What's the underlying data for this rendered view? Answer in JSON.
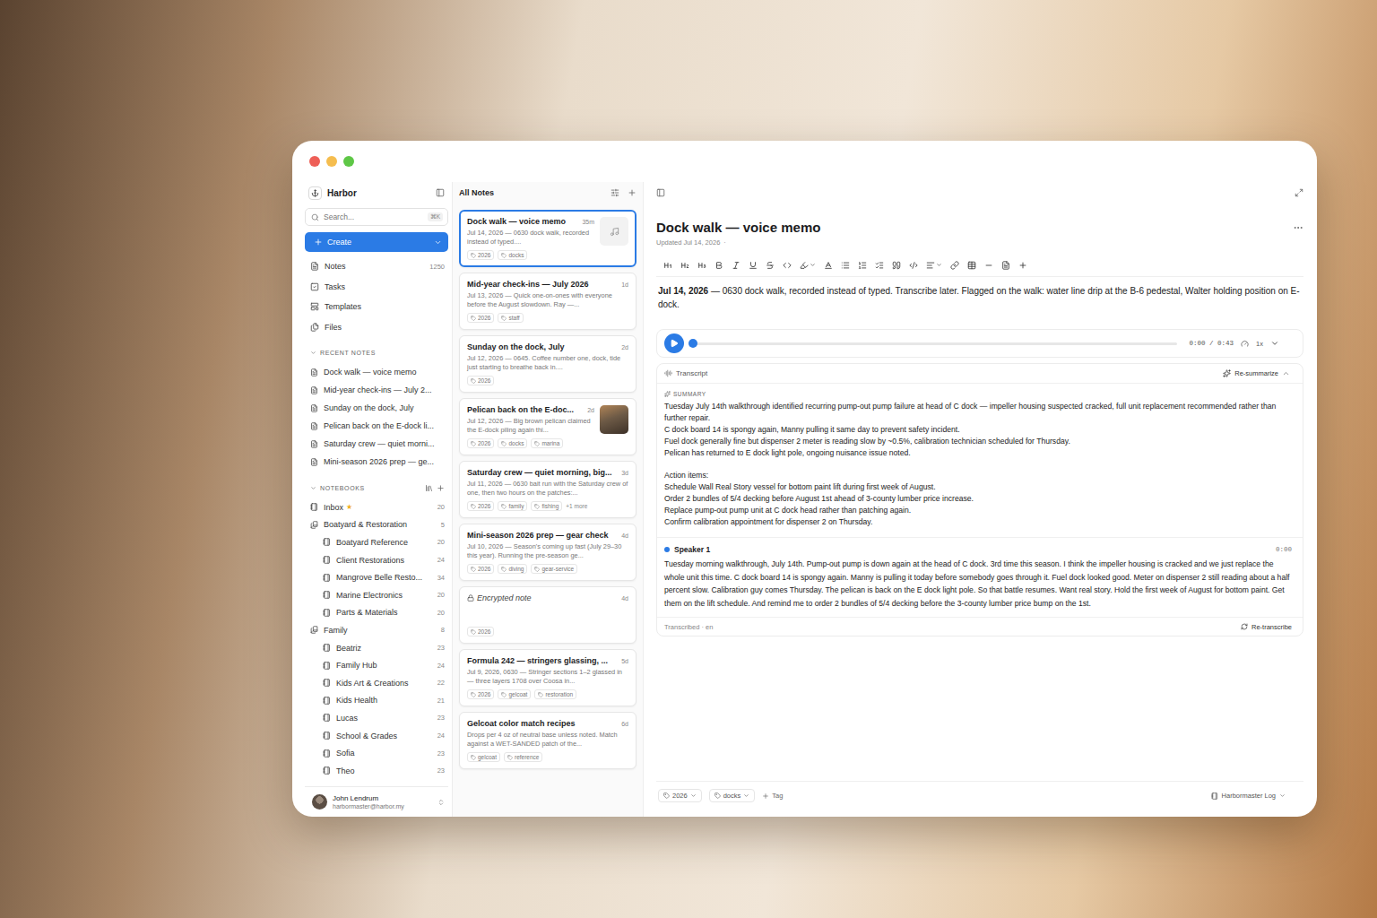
{
  "window": {
    "title": "Harbor"
  },
  "sidebar": {
    "app_name": "Harbor",
    "search": {
      "placeholder": "Search...",
      "shortcut": "⌘K"
    },
    "create_button": "Create",
    "nav": [
      {
        "label": "Notes",
        "count": "1250"
      },
      {
        "label": "Tasks"
      },
      {
        "label": "Templates"
      },
      {
        "label": "Files"
      }
    ],
    "recent_heading": "RECENT NOTES",
    "recent": [
      "Dock walk — voice memo",
      "Mid-year check-ins — July 2...",
      "Sunday on the dock, July",
      "Pelican back on the E-dock li...",
      "Saturday crew — quiet morni...",
      "Mini-season 2026 prep — ge..."
    ],
    "notebooks_heading": "NOTEBOOKS",
    "notebooks": [
      {
        "kind": "notebook",
        "label": "Inbox",
        "count": "20",
        "starred": true
      },
      {
        "kind": "group",
        "label": "Boatyard & Restoration",
        "count": "5",
        "starred": false
      },
      {
        "kind": "child",
        "label": "Boatyard Reference",
        "count": "20",
        "starred": false
      },
      {
        "kind": "child",
        "label": "Client Restorations",
        "count": "24",
        "starred": false
      },
      {
        "kind": "child",
        "label": "Mangrove Belle Resto...",
        "count": "34",
        "starred": false
      },
      {
        "kind": "child",
        "label": "Marine Electronics",
        "count": "20",
        "starred": false
      },
      {
        "kind": "child",
        "label": "Parts & Materials",
        "count": "20",
        "starred": false
      },
      {
        "kind": "group",
        "label": "Family",
        "count": "8",
        "starred": false
      },
      {
        "kind": "child",
        "label": "Beatriz",
        "count": "23",
        "starred": false
      },
      {
        "kind": "child",
        "label": "Family Hub",
        "count": "24",
        "starred": false
      },
      {
        "kind": "child",
        "label": "Kids Art & Creations",
        "count": "22",
        "starred": false
      },
      {
        "kind": "child",
        "label": "Kids Health",
        "count": "21",
        "starred": false
      },
      {
        "kind": "child",
        "label": "Lucas",
        "count": "23",
        "starred": false
      },
      {
        "kind": "child",
        "label": "School & Grades",
        "count": "24",
        "starred": false
      },
      {
        "kind": "child",
        "label": "Sofia",
        "count": "23",
        "starred": false
      },
      {
        "kind": "child",
        "label": "Theo",
        "count": "23",
        "starred": false
      }
    ],
    "star": "★",
    "user": {
      "name": "John Lendrum",
      "email": "harbormaster@harbor.my"
    }
  },
  "note_list": {
    "title": "All Notes",
    "notes": [
      {
        "kind": "audio",
        "selected": true,
        "title": "Dock walk — voice memo",
        "age": "35m",
        "snippet": "Jul 14, 2026 — 0630 dock walk, recorded instead of typed....",
        "tags": [
          "2026",
          "docks"
        ]
      },
      {
        "kind": "plain",
        "selected": false,
        "title": "Mid-year check-ins — July 2026",
        "age": "1d",
        "snippet": "Jul 13, 2026 — Quick one-on-ones with everyone before the August slowdown. Ray —...",
        "tags": [
          "2026",
          "staff"
        ]
      },
      {
        "kind": "plain",
        "selected": false,
        "title": "Sunday on the dock, July",
        "age": "2d",
        "snippet": "Jul 12, 2026 — 0645. Coffee number one, dock, tide just starting to breathe back in....",
        "tags": [
          "2026"
        ]
      },
      {
        "kind": "photo",
        "selected": false,
        "title": "Pelican back on the E-doc...",
        "age": "2d",
        "snippet": "Jul 12, 2026 — Big brown pelican claimed the E-dock piling again thi...",
        "tags": [
          "2026",
          "docks",
          "marina"
        ]
      },
      {
        "kind": "plain",
        "selected": false,
        "title": "Saturday crew — quiet morning, big...",
        "age": "3d",
        "snippet": "Jul 11, 2026 — 0630 bait run with the Saturday crew of one, then two hours on the patches:...",
        "tags": [
          "2026",
          "family",
          "fishing"
        ],
        "more": "+1 more"
      },
      {
        "kind": "plain",
        "selected": false,
        "title": "Mini-season 2026 prep — gear check",
        "age": "4d",
        "snippet": "Jul 10, 2026 — Season's coming up fast (July 29–30 this year). Running the pre-season ge...",
        "tags": [
          "2026",
          "diving",
          "gear-service"
        ]
      },
      {
        "kind": "encrypted",
        "selected": false,
        "title": "Encrypted note",
        "age": "4d",
        "snippet": "",
        "tags": [
          "2026"
        ]
      },
      {
        "kind": "plain",
        "selected": false,
        "title": "Formula 242 — stringers glassing, ...",
        "age": "5d",
        "snippet": "Jul 9, 2026, 0630 — Stringer sections 1–2 glassed in — three layers 1708 over Coosa in...",
        "tags": [
          "2026",
          "gelcoat",
          "restoration"
        ]
      },
      {
        "kind": "plain",
        "selected": false,
        "title": "Gelcoat color match recipes",
        "age": "6d",
        "snippet": "Drops per 4 oz of neutral base unless noted. Match against a WET-SANDED patch of the...",
        "tags": [
          "gelcoat",
          "reference"
        ]
      }
    ]
  },
  "editor": {
    "title": "Dock walk — voice memo",
    "updated": "Updated Jul 14, 2026",
    "updated_sep": "·",
    "body_date": "Jul 14, 2026",
    "body_text": " — 0630 dock walk, recorded instead of typed. Transcribe later. Flagged on the walk: water line drip at the B-6 pedestal, Walter holding position on E-dock.",
    "player": {
      "time": "0:00 / 0:43",
      "speed": "1x",
      "level": 0
    },
    "transcript": {
      "label": "Transcript",
      "resummarize": "Re-summarize",
      "summary_heading": "SUMMARY",
      "summary": [
        "Tuesday July 14th walkthrough identified recurring pump-out pump failure at head of C dock — impeller housing suspected cracked, full unit replacement recommended rather than further repair.",
        "C dock board 14 is spongy again, Manny pulling it same day to prevent safety incident.",
        "Fuel dock generally fine but dispenser 2 meter is reading slow by ~0.5%, calibration technician scheduled for Thursday.",
        "Pelican has returned to E dock light pole, ongoing nuisance issue noted."
      ],
      "action_heading": "Action items:",
      "actions": [
        "Schedule Wall Real Story vessel for bottom paint lift during first week of August.",
        "Order 2 bundles of 5/4 decking before August 1st ahead of 3-county lumber price increase.",
        "Replace pump-out pump unit at C dock head rather than patching again.",
        "Confirm calibration appointment for dispenser 2 on Thursday."
      ],
      "speaker": "Speaker 1",
      "speaker_time": "0:00",
      "text": "Tuesday morning walkthrough, July 14th. Pump-out pump is down again at the head of C dock. 3rd time this season. I think the impeller housing is cracked and we just replace the whole unit this time. C dock board 14 is spongy again. Manny is pulling it today before somebody goes through it. Fuel dock looked good. Meter on dispenser 2 still reading about a half percent slow. Calibration guy comes Thursday. The pelican is back on the E dock light pole. So that battle resumes. Want real story. Hold the first week of August for bottom paint. Get them on the lift schedule. And remind me to order 2 bundles of 5/4 decking before the 3-county lumber price bump on the 1st.",
      "footer": "Transcribed · en",
      "retranscribe": "Re-transcribe"
    },
    "tags": [
      "2026",
      "docks"
    ],
    "add_tag": "Tag",
    "notebook": "Harbormaster Log"
  }
}
